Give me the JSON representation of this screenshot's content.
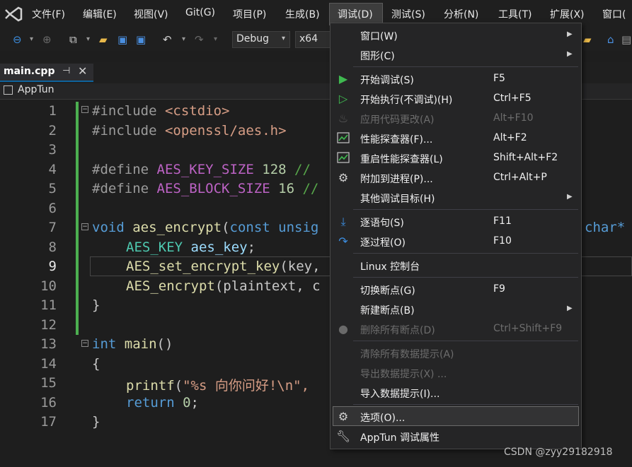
{
  "menubar": {
    "items": [
      "文件(F)",
      "编辑(E)",
      "视图(V)",
      "Git(G)",
      "项目(P)",
      "生成(B)",
      "调试(D)",
      "测试(S)",
      "分析(N)",
      "工具(T)",
      "扩展(X)",
      "窗口("
    ]
  },
  "toolbar": {
    "config": "Debug",
    "platform": "x64"
  },
  "editor": {
    "tab_name": "main.cpp",
    "project": "AppTun",
    "line_numbers": [
      "1",
      "2",
      "3",
      "4",
      "5",
      "6",
      "7",
      "8",
      "9",
      "10",
      "11",
      "12",
      "13",
      "14",
      "15",
      "16",
      "17"
    ],
    "lines": {
      "l1a": "#include",
      "l1b": "<cstdio>",
      "l2a": "#include",
      "l2b": "<openssl/aes.h>",
      "l4a": "#define",
      "l4b": "AES_KEY_SIZE",
      "l4c": "128",
      "l4d": "//",
      "l5a": "#define",
      "l5b": "AES_BLOCK_SIZE",
      "l5c": "16",
      "l5d": "//",
      "l7a": "void",
      "l7b": "aes_encrypt",
      "l7c": "(",
      "l7d": "const",
      "l7e": "unsig",
      "l7f": "char*",
      "l8a": "AES_KEY",
      "l8b": "aes_key",
      "l8c": ";",
      "l9a": "AES_set_encrypt_key",
      "l9b": "(key,",
      "l10a": "AES_encrypt",
      "l10b": "(plaintext, c",
      "l11": "}",
      "l13a": "int",
      "l13b": "main",
      "l13c": "()",
      "l14": "{",
      "l15a": "printf",
      "l15b": "(",
      "l15c": "\"%s 向你问好!\\n\",",
      "l16a": "return",
      "l16b": "0",
      "l16c": ";",
      "l17": "}"
    }
  },
  "debug_menu": {
    "items": [
      {
        "label": "窗口(W)",
        "shortcut": "",
        "icon": "",
        "submenu": true,
        "disabled": false
      },
      {
        "label": "图形(C)",
        "shortcut": "",
        "icon": "",
        "submenu": true,
        "disabled": false
      },
      {
        "label": "开始调试(S)",
        "shortcut": "F5",
        "icon": "play-solid-icon",
        "submenu": false,
        "disabled": false
      },
      {
        "label": "开始执行(不调试)(H)",
        "shortcut": "Ctrl+F5",
        "icon": "play-outline-icon",
        "submenu": false,
        "disabled": false
      },
      {
        "label": "应用代码更改(A)",
        "shortcut": "Alt+F10",
        "icon": "flame-icon",
        "submenu": false,
        "disabled": true
      },
      {
        "label": "性能探查器(F)...",
        "shortcut": "Alt+F2",
        "icon": "performance-chart-icon",
        "submenu": false,
        "disabled": false
      },
      {
        "label": "重启性能探查器(L)",
        "shortcut": "Shift+Alt+F2",
        "icon": "performance-restart-icon",
        "submenu": false,
        "disabled": false
      },
      {
        "label": "附加到进程(P)...",
        "shortcut": "Ctrl+Alt+P",
        "icon": "gears-icon",
        "submenu": false,
        "disabled": false
      },
      {
        "label": "其他调试目标(H)",
        "shortcut": "",
        "icon": "",
        "submenu": true,
        "disabled": false
      },
      {
        "label": "逐语句(S)",
        "shortcut": "F11",
        "icon": "step-into-icon",
        "submenu": false,
        "disabled": false
      },
      {
        "label": "逐过程(O)",
        "shortcut": "F10",
        "icon": "step-over-icon",
        "submenu": false,
        "disabled": false
      },
      {
        "label": "Linux 控制台",
        "shortcut": "",
        "icon": "",
        "submenu": false,
        "disabled": false
      },
      {
        "label": "切换断点(G)",
        "shortcut": "F9",
        "icon": "",
        "submenu": false,
        "disabled": false
      },
      {
        "label": "新建断点(B)",
        "shortcut": "",
        "icon": "",
        "submenu": true,
        "disabled": false
      },
      {
        "label": "删除所有断点(D)",
        "shortcut": "Ctrl+Shift+F9",
        "icon": "delete-breakpoints-icon",
        "submenu": false,
        "disabled": true
      },
      {
        "label": "清除所有数据提示(A)",
        "shortcut": "",
        "icon": "",
        "submenu": false,
        "disabled": true
      },
      {
        "label": "导出数据提示(X) ...",
        "shortcut": "",
        "icon": "",
        "submenu": false,
        "disabled": true
      },
      {
        "label": "导入数据提示(I)...",
        "shortcut": "",
        "icon": "",
        "submenu": false,
        "disabled": false
      },
      {
        "label": "选项(O)...",
        "shortcut": "",
        "icon": "gear-icon",
        "submenu": false,
        "disabled": false
      },
      {
        "label": "AppTun 调试属性",
        "shortcut": "",
        "icon": "wrench-icon",
        "submenu": false,
        "disabled": false
      }
    ]
  },
  "colors": {
    "accent": "#0e639c",
    "change_bar": "#4caf50",
    "play_green": "#3fb950"
  },
  "watermark": "CSDN @zyy29182918"
}
